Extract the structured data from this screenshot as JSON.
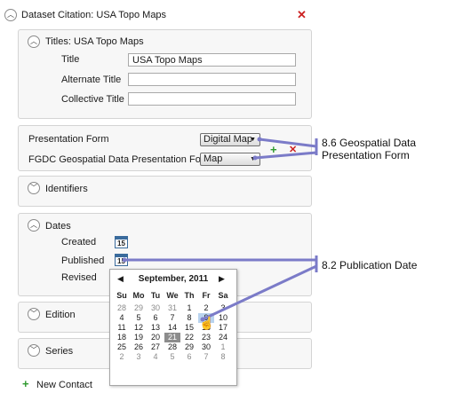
{
  "header": {
    "title": "Dataset Citation:  USA Topo Maps",
    "close_icon": "close-x-icon",
    "close_color": "#cc2222"
  },
  "titles": {
    "heading": "Titles:  USA Topo Maps",
    "title_label": "Title",
    "title_value": "USA Topo Maps",
    "alternate_label": "Alternate Title",
    "alternate_value": "",
    "collective_label": "Collective Title",
    "collective_value": ""
  },
  "presentation": {
    "form_label": "Presentation Form",
    "form_value": "Digital Map",
    "fgdc_label": "FGDC Geospatial Data Presentation Form",
    "fgdc_value": "Map"
  },
  "identifiers": {
    "label": "Identifiers"
  },
  "dates": {
    "label": "Dates",
    "created_label": "Created",
    "published_label": "Published",
    "revised_label": "Revised",
    "icon_day": "15"
  },
  "calendar": {
    "month": "September, 2011",
    "weekdays": [
      "Su",
      "Mo",
      "Tu",
      "We",
      "Th",
      "Fr",
      "Sa"
    ],
    "weeks": [
      [
        "28",
        "29",
        "30",
        "31",
        "1",
        "2",
        "3"
      ],
      [
        "4",
        "5",
        "6",
        "7",
        "8",
        "9",
        "10"
      ],
      [
        "11",
        "12",
        "13",
        "14",
        "15",
        "16",
        "17"
      ],
      [
        "18",
        "19",
        "20",
        "21",
        "22",
        "23",
        "24"
      ],
      [
        "25",
        "26",
        "27",
        "28",
        "29",
        "30",
        "1"
      ],
      [
        "2",
        "3",
        "4",
        "5",
        "6",
        "7",
        "8"
      ]
    ]
  },
  "edition": {
    "label": "Edition"
  },
  "series": {
    "label": "Series"
  },
  "new_contact": {
    "label": "New Contact"
  },
  "annotations": {
    "geospatial_line1": "8.6 Geospatial Data",
    "geospatial_line2": "Presentation Form",
    "publication": "8.2 Publication Date"
  },
  "colors": {
    "annotation_line": "#7b7bc8",
    "add_icon": "#2f9a2f"
  }
}
